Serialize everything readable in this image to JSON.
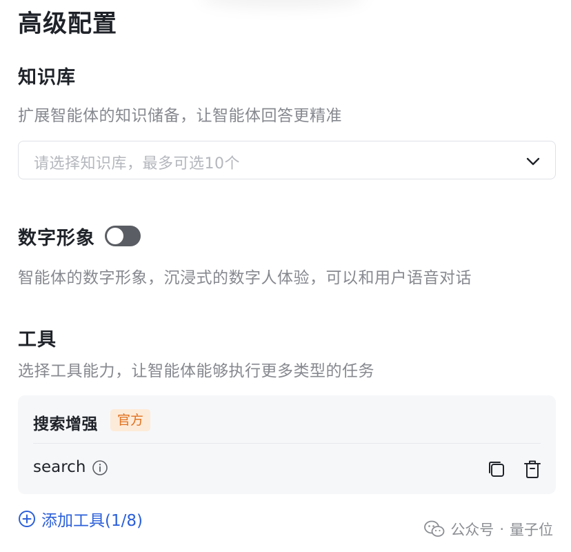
{
  "page": {
    "title": "高级配置"
  },
  "knowledge_base": {
    "title": "知识库",
    "description": "扩展智能体的知识储备，让智能体回答更精准",
    "select_placeholder": "请选择知识库，最多可选10个",
    "chevron_icon": "chevron-down-icon"
  },
  "digital_avatar": {
    "title": "数字形象",
    "enabled": false,
    "description": "智能体的数字形象，沉浸式的数字人体验，可以和用户语音对话"
  },
  "tools": {
    "title": "工具",
    "description": "选择工具能力，让智能体能够执行更多类型的任务",
    "items": [
      {
        "name": "搜索增强",
        "badge": "官方",
        "api_name": "search",
        "icons": [
          "info-icon",
          "copy-icon",
          "delete-icon"
        ]
      }
    ],
    "add_label": "添加工具(1/8)"
  },
  "watermark": {
    "brand": "公众号",
    "separator": "·",
    "name": "量子位"
  },
  "colors": {
    "accent": "#2b5fd9",
    "badge_text": "#e0701e",
    "badge_bg": "#fdebd9",
    "muted_text": "#86888f",
    "toggle_off": "#5a5d63",
    "card_bg": "#f6f7f9"
  }
}
